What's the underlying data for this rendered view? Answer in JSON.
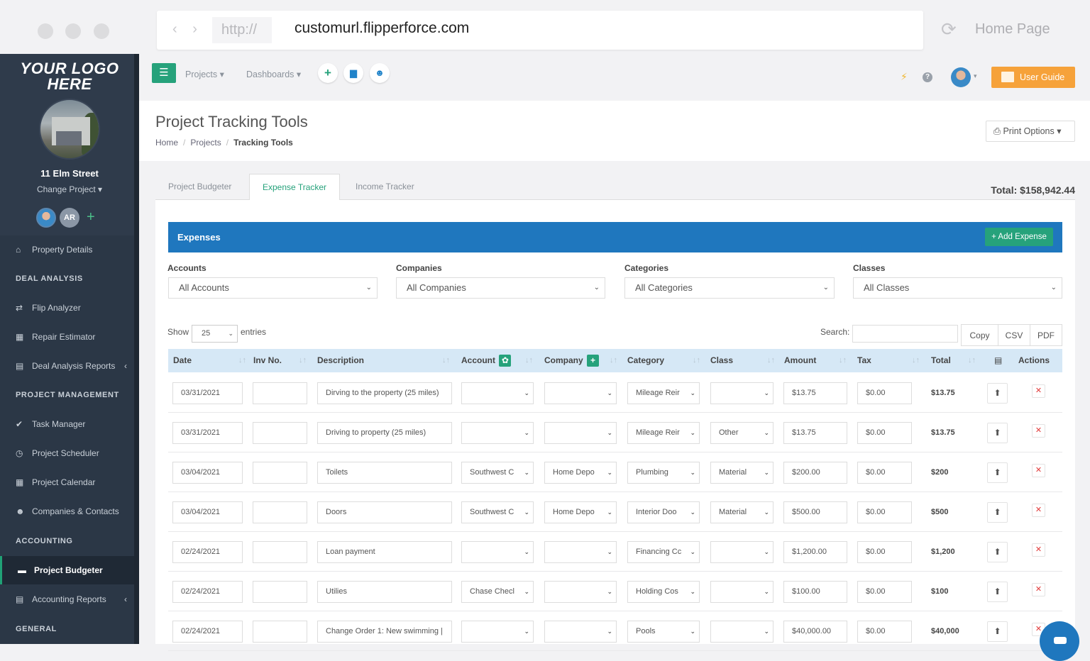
{
  "browser": {
    "protocol": "http://",
    "url": "customurl.flipperforce.com",
    "home_page": "Home Page",
    "nav_arrows": "‹ ›",
    "reload_glyph": "⟳"
  },
  "sidebar": {
    "logo_line1": "YOUR LOGO",
    "logo_line2": "HERE",
    "property_name": "11 Elm Street",
    "change_project": "Change Project ▾",
    "avatar_initials": "AR",
    "add_glyph": "+",
    "items": [
      {
        "label": "Property Details",
        "icon": "home-icon",
        "glyph": "⌂"
      },
      {
        "label": "Flip Analyzer",
        "icon": "exchange-icon",
        "glyph": "⇄"
      },
      {
        "label": "Repair Estimator",
        "icon": "calculator-icon",
        "glyph": "▦"
      },
      {
        "label": "Deal Analysis Reports",
        "icon": "file-icon",
        "glyph": "▤"
      },
      {
        "label": "Task Manager",
        "icon": "check-circle-icon",
        "glyph": "✔"
      },
      {
        "label": "Project Scheduler",
        "icon": "clock-icon",
        "glyph": "◷"
      },
      {
        "label": "Project Calendar",
        "icon": "calendar-icon",
        "glyph": "▦"
      },
      {
        "label": "Companies & Contacts",
        "icon": "users-icon",
        "glyph": "☻"
      },
      {
        "label": "Project Budgeter",
        "icon": "money-icon",
        "glyph": "▬"
      },
      {
        "label": "Accounting Reports",
        "icon": "file-icon",
        "glyph": "▤"
      }
    ],
    "headings": {
      "deal_analysis": "DEAL ANALYSIS",
      "project_management": "PROJECT MANAGEMENT",
      "accounting": "ACCOUNTING",
      "general": "GENERAL"
    },
    "chevron": "‹"
  },
  "toolbar": {
    "menu_glyph": "☰",
    "projects": "Projects ▾",
    "dashboards": "Dashboards ▾",
    "add_glyph": "+",
    "calendar_glyph": "▆",
    "users_glyph": "☻",
    "bolt_glyph": "⚡",
    "help_glyph": "?",
    "user_caret": "▾",
    "user_guide": "User Guide"
  },
  "header": {
    "title": "Project Tracking Tools",
    "breadcrumb": [
      "Home",
      "Projects",
      "Tracking Tools"
    ],
    "separator": "/",
    "print_options": "⎙ Print Options ▾"
  },
  "tabs": [
    "Project Budgeter",
    "Expense Tracker",
    "Income Tracker"
  ],
  "total": "Total: $158,942.44",
  "expenses": {
    "title": "Expenses",
    "add_button": "+ Add Expense",
    "filters": [
      {
        "label": "Accounts",
        "value": "All Accounts"
      },
      {
        "label": "Companies",
        "value": "All Companies"
      },
      {
        "label": "Categories",
        "value": "All Categories"
      },
      {
        "label": "Classes",
        "value": "All Classes"
      }
    ],
    "show_label": "Show",
    "show_value": "25",
    "entries_label": "entries",
    "search_label": "Search:",
    "buttons": [
      "Copy",
      "CSV",
      "PDF"
    ],
    "columns": [
      "Date",
      "Inv No.",
      "Description",
      "Account",
      "Company",
      "Category",
      "Class",
      "Amount",
      "Tax",
      "Total",
      "Actions"
    ],
    "column_plus_glyph": "+",
    "column_gear_glyph": "✿",
    "sort_glyph": "↓↑",
    "file_icon_glyph": "▤",
    "dropdown_glyph": "⌄",
    "upload_glyph": "⬆",
    "delete_glyph": "✕",
    "rows": [
      {
        "date": "03/31/2021",
        "inv": "",
        "desc": "Dirving to the property (25 miles)",
        "account": "",
        "company": "",
        "category": "Mileage Reir",
        "class": "",
        "amount": "$13.75",
        "tax": "$0.00",
        "total": "$13.75"
      },
      {
        "date": "03/31/2021",
        "inv": "",
        "desc": "Driving to property (25 miles)",
        "account": "",
        "company": "",
        "category": "Mileage Reir",
        "class": "Other",
        "amount": "$13.75",
        "tax": "$0.00",
        "total": "$13.75"
      },
      {
        "date": "03/04/2021",
        "inv": "",
        "desc": "Toilets",
        "account": "Southwest C",
        "company": "Home Depo",
        "category": "Plumbing",
        "class": "Material",
        "amount": "$200.00",
        "tax": "$0.00",
        "total": "$200"
      },
      {
        "date": "03/04/2021",
        "inv": "",
        "desc": "Doors",
        "account": "Southwest C",
        "company": "Home Depo",
        "category": "Interior Doo",
        "class": "Material",
        "amount": "$500.00",
        "tax": "$0.00",
        "total": "$500"
      },
      {
        "date": "02/24/2021",
        "inv": "",
        "desc": "Loan payment",
        "account": "",
        "company": "",
        "category": "Financing Cc",
        "class": "",
        "amount": "$1,200.00",
        "tax": "$0.00",
        "total": "$1,200"
      },
      {
        "date": "02/24/2021",
        "inv": "",
        "desc": "Utilies",
        "account": "Chase Checl",
        "company": "",
        "category": "Holding Cos",
        "class": "",
        "amount": "$100.00",
        "tax": "$0.00",
        "total": "$100"
      },
      {
        "date": "02/24/2021",
        "inv": "",
        "desc": "Change Order 1: New swimming |",
        "account": "",
        "company": "",
        "category": "Pools",
        "class": "",
        "amount": "$40,000.00",
        "tax": "$0.00",
        "total": "$40,000"
      }
    ]
  },
  "colors": {
    "accent": "#26a27b",
    "header_blue": "#1f77be",
    "sidebar": "#2f3b4b",
    "user_guide": "#f6a23a",
    "delete": "#e23b3b"
  }
}
